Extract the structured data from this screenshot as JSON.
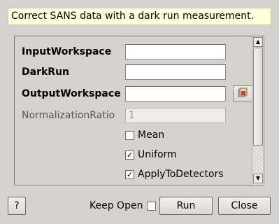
{
  "description": "Correct SANS data with a dark run measurement.",
  "properties": {
    "input_workspace": {
      "label": "InputWorkspace",
      "value": ""
    },
    "dark_run": {
      "label": "DarkRun",
      "value": ""
    },
    "output_workspace": {
      "label": "OutputWorkspace",
      "value": ""
    },
    "normalization_ratio": {
      "label": "NormalizationRatio",
      "placeholder": "1"
    },
    "mean": {
      "label": "Mean",
      "checked": false
    },
    "uniform": {
      "label": "Uniform",
      "checked": true,
      "mark": "✓"
    },
    "apply_to_detectors": {
      "label": "ApplyToDetectors",
      "checked": true,
      "mark": "✓"
    }
  },
  "footer": {
    "help_label": "?",
    "keep_open_label": "Keep Open",
    "keep_open_checked": false,
    "run_label": "Run",
    "close_label": "Close"
  },
  "icons": {
    "browse": "folder-browse-icon",
    "scroll_up": "arrow-up-icon",
    "scroll_down": "arrow-down-icon"
  },
  "scroll": {
    "thumb_fraction": 0.77
  }
}
